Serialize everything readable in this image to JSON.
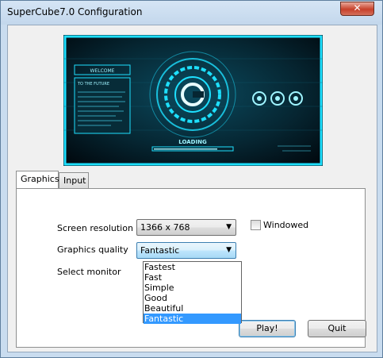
{
  "window": {
    "title": "SuperCube7.0 Configuration",
    "close_glyph": "✕"
  },
  "banner": {
    "welcome": "WELCOME",
    "subtitle": "TO THE FUTURE",
    "loading": "LOADING"
  },
  "tabs": [
    {
      "label": "Graphics",
      "active": true
    },
    {
      "label": "Input",
      "active": false
    }
  ],
  "graphics": {
    "screen_resolution_label": "Screen resolution",
    "screen_resolution_value": "1366 x 768",
    "windowed_label": "Windowed",
    "windowed_checked": false,
    "quality_label": "Graphics quality",
    "quality_value": "Fantastic",
    "monitor_label": "Select monitor",
    "quality_options": [
      "Fastest",
      "Fast",
      "Simple",
      "Good",
      "Beautiful",
      "Fantastic"
    ],
    "quality_selected_index": 5
  },
  "buttons": {
    "play": "Play!",
    "quit": "Quit"
  },
  "colors": {
    "selection": "#3399ff",
    "banner_cyan": "#1ee0ff",
    "close_red": "#c7402a"
  }
}
